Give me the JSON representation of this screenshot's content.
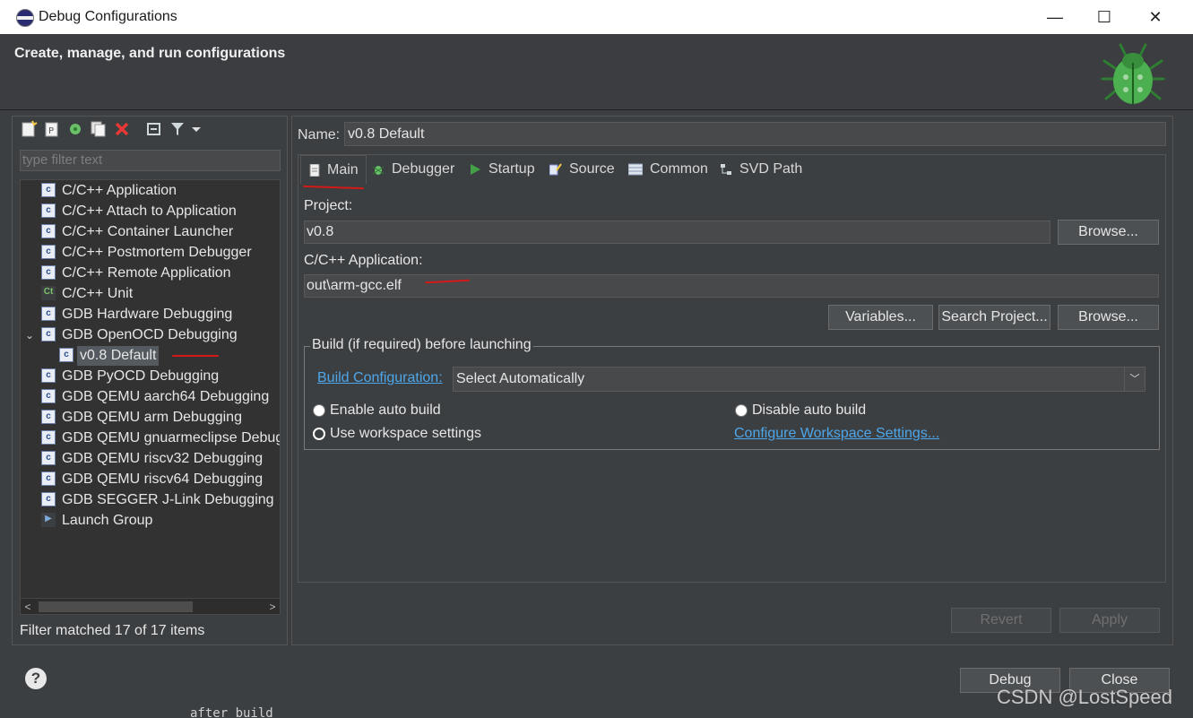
{
  "window": {
    "title": "Debug Configurations"
  },
  "header": {
    "title": "Create, manage, and run configurations"
  },
  "filter": {
    "placeholder": "type filter text"
  },
  "tree": {
    "items": [
      {
        "label": "C/C++ Application",
        "icon": "c-launch-icon"
      },
      {
        "label": "C/C++ Attach to Application",
        "icon": "c-launch-icon"
      },
      {
        "label": "C/C++ Container Launcher",
        "icon": "c-launch-icon"
      },
      {
        "label": "C/C++ Postmortem Debugger",
        "icon": "c-launch-icon"
      },
      {
        "label": "C/C++ Remote Application",
        "icon": "c-launch-icon"
      },
      {
        "label": "C/C++ Unit",
        "icon": "unit-test-icon"
      },
      {
        "label": "GDB Hardware Debugging",
        "icon": "c-launch-icon"
      },
      {
        "label": "GDB OpenOCD Debugging",
        "icon": "c-launch-icon"
      },
      {
        "label": "v0.8 Default",
        "icon": "c-launch-icon"
      },
      {
        "label": "GDB PyOCD Debugging",
        "icon": "c-launch-icon"
      },
      {
        "label": "GDB QEMU aarch64 Debugging",
        "icon": "c-launch-icon"
      },
      {
        "label": "GDB QEMU arm Debugging",
        "icon": "c-launch-icon"
      },
      {
        "label": "GDB QEMU gnuarmeclipse Debug",
        "icon": "c-launch-icon"
      },
      {
        "label": "GDB QEMU riscv32 Debugging",
        "icon": "c-launch-icon"
      },
      {
        "label": "GDB QEMU riscv64 Debugging",
        "icon": "c-launch-icon"
      },
      {
        "label": "GDB SEGGER J-Link Debugging",
        "icon": "c-launch-icon"
      },
      {
        "label": "Launch Group",
        "icon": "launch-group-icon"
      }
    ],
    "status": "Filter matched 17 of 17 items"
  },
  "config": {
    "name_label": "Name:",
    "name_value": "v0.8 Default",
    "tabs": [
      {
        "label": "Main"
      },
      {
        "label": "Debugger"
      },
      {
        "label": "Startup"
      },
      {
        "label": "Source"
      },
      {
        "label": "Common"
      },
      {
        "label": "SVD Path"
      }
    ],
    "project_label": "Project:",
    "project_value": "v0.8",
    "browse_label": "Browse...",
    "app_label": "C/C++ Application:",
    "app_value": "out\\arm-gcc.elf",
    "variables_label": "Variables...",
    "search_project_label": "Search Project...",
    "browse2_label": "Browse...",
    "build_group_label": "Build (if required) before launching",
    "build_config_link": "Build Configuration:",
    "build_config_value": "Select Automatically",
    "enable_auto_build": "Enable auto build",
    "disable_auto_build": "Disable auto build",
    "use_workspace": "Use workspace settings",
    "configure_workspace": "Configure Workspace Settings...",
    "revert": "Revert",
    "apply": "Apply"
  },
  "footer": {
    "debug": "Debug",
    "close": "Close"
  },
  "watermark": "CSDN @LostSpeed",
  "background_text": "after build",
  "colors": {
    "accent_link": "#4ea6ea",
    "annotation_red": "#d41919"
  }
}
